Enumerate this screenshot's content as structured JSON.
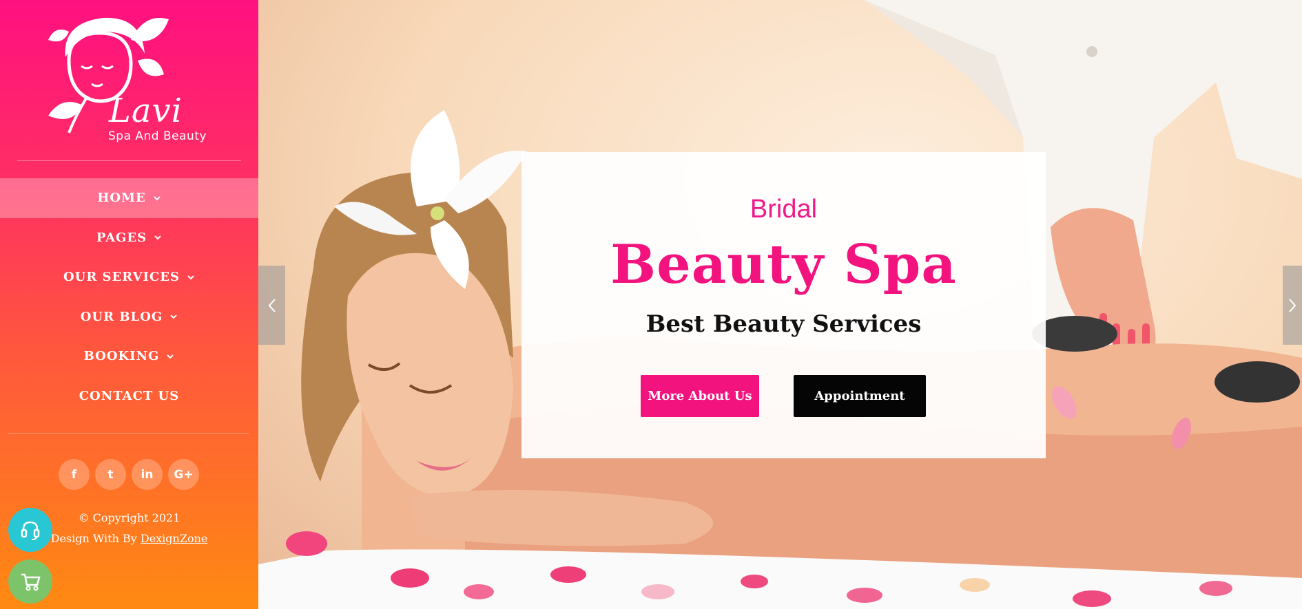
{
  "brand": {
    "name": "Lavi",
    "tagline": "Spa And Beauty"
  },
  "nav": {
    "items": [
      {
        "label": "HOME",
        "has_dropdown": true,
        "active": true
      },
      {
        "label": "PAGES",
        "has_dropdown": true,
        "active": false
      },
      {
        "label": "OUR SERVICES",
        "has_dropdown": true,
        "active": false
      },
      {
        "label": "OUR BLOG",
        "has_dropdown": true,
        "active": false
      },
      {
        "label": "BOOKING",
        "has_dropdown": true,
        "active": false
      },
      {
        "label": "CONTACT US",
        "has_dropdown": false,
        "active": false
      }
    ]
  },
  "socials": [
    {
      "icon": "facebook-icon",
      "glyph": "f"
    },
    {
      "icon": "twitter-icon",
      "glyph": "t"
    },
    {
      "icon": "linkedin-icon",
      "glyph": "in"
    },
    {
      "icon": "google-plus-icon",
      "glyph": "G+"
    }
  ],
  "footer": {
    "copyright": "© Copyright 2021",
    "design_prefix": "Design With By",
    "design_link": "DexignZone"
  },
  "floating": {
    "support_icon": "headset-icon",
    "cart_icon": "cart-icon"
  },
  "hero": {
    "pre_title": "Bridal",
    "title": "Beauty Spa",
    "subtitle": "Best Beauty Services",
    "primary_button": "More About Us",
    "secondary_button": "Appointment"
  },
  "colors": {
    "accent": "#f2137f",
    "sidebar_top": "#ff1080",
    "sidebar_bottom": "#ff8a12",
    "support_button": "#28c7d3",
    "cart_button": "#7dc36a",
    "dark_button": "#050505"
  }
}
